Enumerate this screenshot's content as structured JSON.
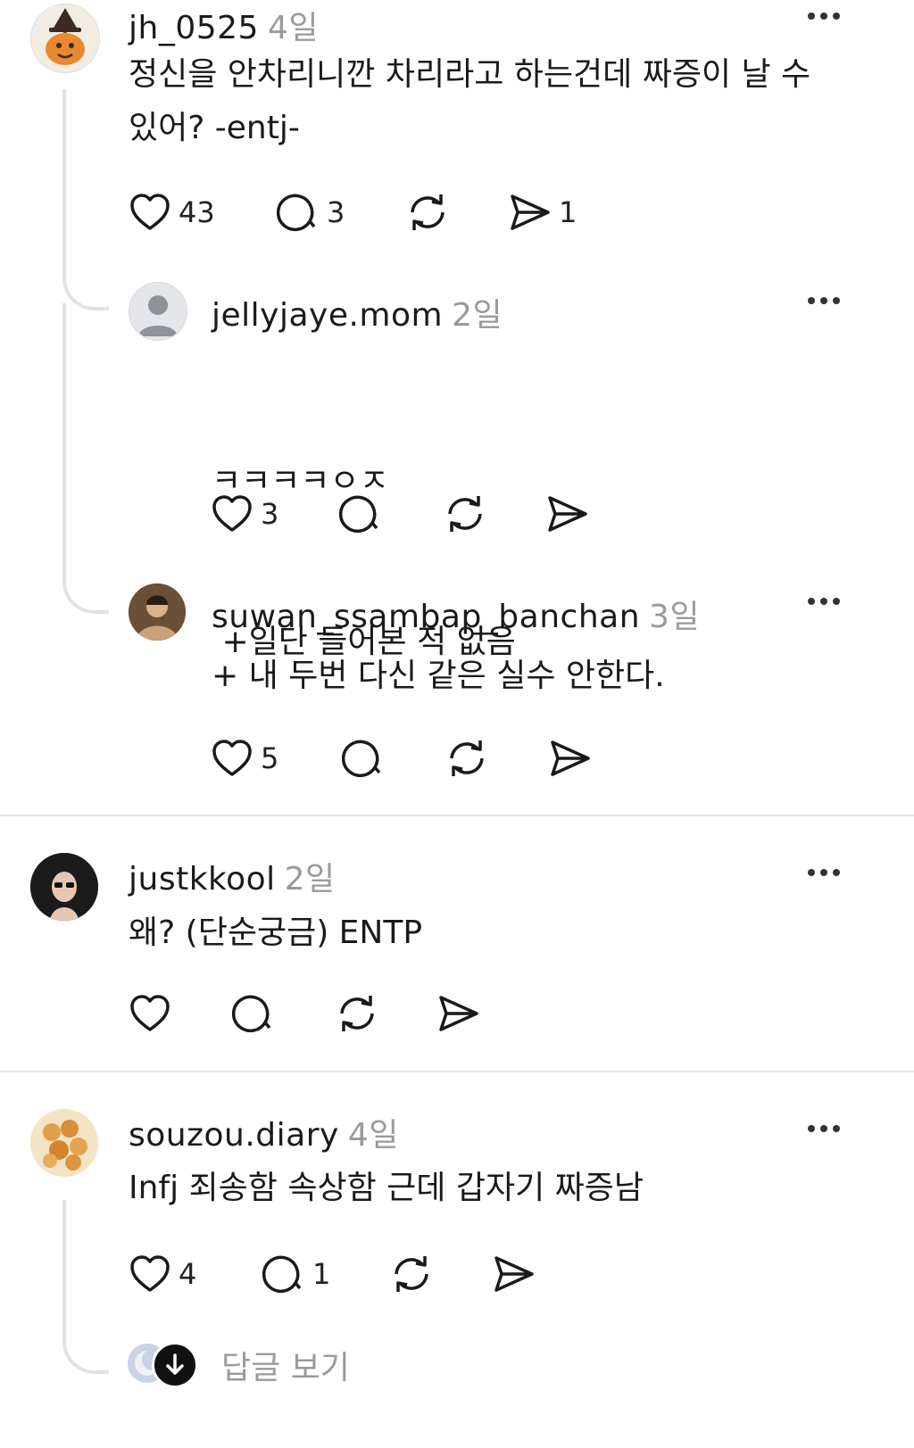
{
  "comments": [
    {
      "username": "jh_0525",
      "time": "4일",
      "lines": [
        "정신을 안차리니깐 차리라고 하는건데 짜증이 날 수",
        "있어? -entj-"
      ],
      "likes": "43",
      "replies": "3",
      "shares": "1"
    },
    {
      "username": "jellyjaye.mom",
      "time": "2일",
      "lines": [
        "ㅋㅋㅋㅋㅇㅈ",
        " +일단 들어본 적 없음"
      ],
      "likes": "3"
    },
    {
      "username": "suwan_ssambap_banchan",
      "time": "3일",
      "lines": [
        "+ 내 두번 다신 같은 실수 안한다."
      ],
      "likes": "5"
    },
    {
      "username": "justkkool",
      "time": "2일",
      "lines": [
        "왜? (단순궁금) ENTP"
      ]
    },
    {
      "username": "souzou.diary",
      "time": "4일",
      "lines": [
        "Infj 죄송함 속상함 근데 갑자기 짜증남"
      ],
      "likes": "4",
      "replies": "1"
    }
  ],
  "view_replies_label": "답글 보기",
  "icons": {
    "like": "heart-icon",
    "reply": "comment-bubble-icon",
    "repost": "repost-arrows-icon",
    "share": "send-arrow-icon",
    "more": "more-dots-icon",
    "expand": "arrow-down-icon"
  },
  "colors": {
    "text": "#1a1a1a",
    "muted": "#9a9a9a",
    "thread_line": "#e2e2e2"
  }
}
